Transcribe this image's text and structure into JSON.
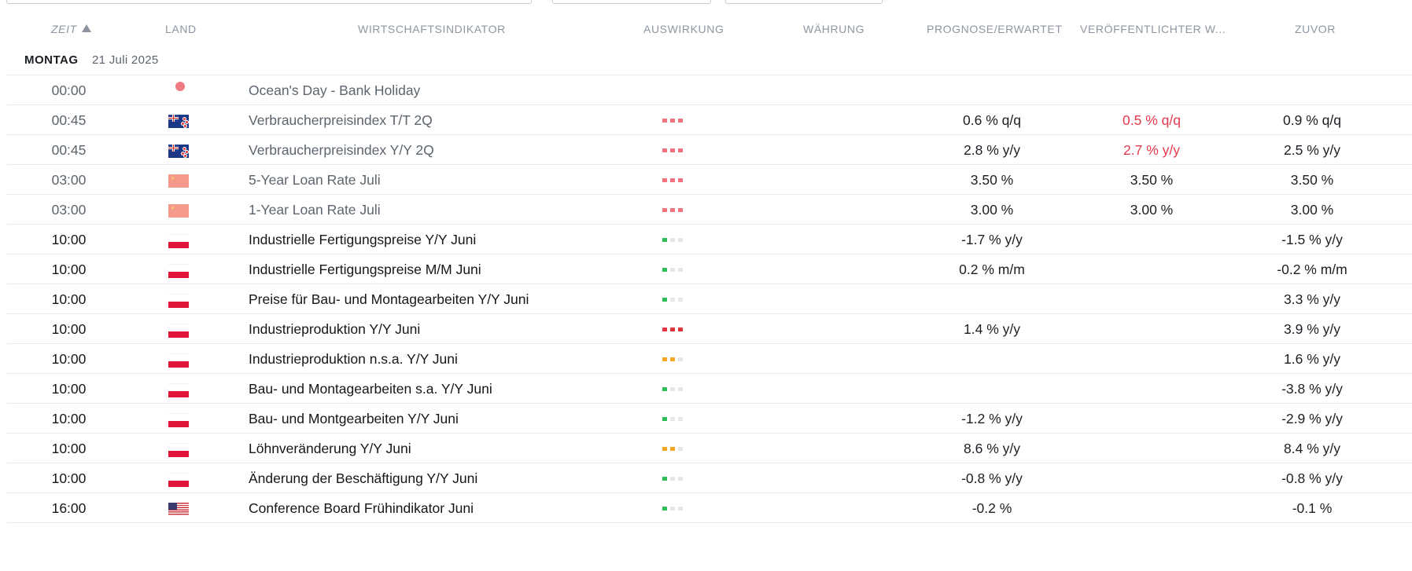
{
  "table_header": {
    "time": "ZEIT",
    "country": "LAND",
    "indicator": "WIRTSCHAFTSINDIKATOR",
    "impact": "AUSWIRKUNG",
    "currency": "WÄHRUNG",
    "forecast": "PROGNOSE/ERWARTET",
    "actual": "VERÖFFENTLICHTER W...",
    "previous": "ZUVOR"
  },
  "day": {
    "name": "MONTAG",
    "date": "21 Juli 2025"
  },
  "events": [
    {
      "time": "00:00",
      "country_icon": "holiday-dot-icon",
      "indicator": "Ocean's Day - Bank Holiday",
      "impact": "none",
      "forecast": "",
      "actual": "",
      "previous": "",
      "state": "past"
    },
    {
      "time": "00:45",
      "country_icon": "new-zealand-flag-icon",
      "indicator": "Verbraucherpreisindex T/T 2Q",
      "impact": "high",
      "forecast": "0.6 % q/q",
      "actual": "0.5 % q/q",
      "actual_color": "#e8384d",
      "previous": "0.9 % q/q",
      "state": "past"
    },
    {
      "time": "00:45",
      "country_icon": "new-zealand-flag-icon",
      "indicator": "Verbraucherpreisindex Y/Y 2Q",
      "impact": "high",
      "forecast": "2.8 % y/y",
      "actual": "2.7 % y/y",
      "actual_color": "#e8384d",
      "previous": "2.5 % y/y",
      "state": "past"
    },
    {
      "time": "03:00",
      "country_icon": "china-flag-icon",
      "indicator": "5-Year Loan Rate Juli",
      "impact": "high",
      "forecast": "3.50 %",
      "actual": "3.50 %",
      "previous": "3.50 %",
      "state": "past"
    },
    {
      "time": "03:00",
      "country_icon": "china-flag-icon",
      "indicator": "1-Year Loan Rate Juli",
      "impact": "high",
      "forecast": "3.00 %",
      "actual": "3.00 %",
      "previous": "3.00 %",
      "state": "past"
    },
    {
      "time": "10:00",
      "country_icon": "poland-flag-icon",
      "indicator": "Industrielle Fertigungspreise Y/Y Juni",
      "impact": "low",
      "forecast": "-1.7 % y/y",
      "actual": "",
      "previous": "-1.5 % y/y",
      "state": "upcoming"
    },
    {
      "time": "10:00",
      "country_icon": "poland-flag-icon",
      "indicator": "Industrielle Fertigungspreise M/M Juni",
      "impact": "low",
      "forecast": "0.2 % m/m",
      "actual": "",
      "previous": "-0.2 % m/m",
      "state": "upcoming"
    },
    {
      "time": "10:00",
      "country_icon": "poland-flag-icon",
      "indicator": "Preise für Bau- und Montagearbeiten Y/Y Juni",
      "impact": "low",
      "forecast": "",
      "actual": "",
      "previous": "3.3 % y/y",
      "state": "upcoming"
    },
    {
      "time": "10:00",
      "country_icon": "poland-flag-icon",
      "indicator": "Industrieproduktion Y/Y Juni",
      "impact": "high-strong",
      "forecast": "1.4 % y/y",
      "actual": "",
      "previous": "3.9 % y/y",
      "state": "upcoming"
    },
    {
      "time": "10:00",
      "country_icon": "poland-flag-icon",
      "indicator": "Industrieproduktion n.s.a. Y/Y Juni",
      "impact": "medium",
      "forecast": "",
      "actual": "",
      "previous": "1.6 % y/y",
      "state": "upcoming"
    },
    {
      "time": "10:00",
      "country_icon": "poland-flag-icon",
      "indicator": "Bau- und Montagearbeiten s.a. Y/Y Juni",
      "impact": "low",
      "forecast": "",
      "actual": "",
      "previous": "-3.8 % y/y",
      "state": "upcoming"
    },
    {
      "time": "10:00",
      "country_icon": "poland-flag-icon",
      "indicator": "Bau- und Montgearbeiten Y/Y Juni",
      "impact": "low",
      "forecast": "-1.2 % y/y",
      "actual": "",
      "previous": "-2.9 % y/y",
      "state": "upcoming"
    },
    {
      "time": "10:00",
      "country_icon": "poland-flag-icon",
      "indicator": "Löhnveränderung Y/Y Juni",
      "impact": "medium",
      "forecast": "8.6 % y/y",
      "actual": "",
      "previous": "8.4 % y/y",
      "state": "upcoming"
    },
    {
      "time": "10:00",
      "country_icon": "poland-flag-icon",
      "indicator": "Änderung der Beschäftigung Y/Y Juni",
      "impact": "low",
      "forecast": "-0.8 % y/y",
      "actual": "",
      "previous": "-0.8 % y/y",
      "state": "upcoming"
    },
    {
      "time": "16:00",
      "country_icon": "usa-flag-icon",
      "indicator": "Conference Board Frühindikator Juni",
      "impact": "low",
      "forecast": "-0.2 %",
      "actual": "",
      "previous": "-0.1 %",
      "state": "upcoming"
    }
  ]
}
